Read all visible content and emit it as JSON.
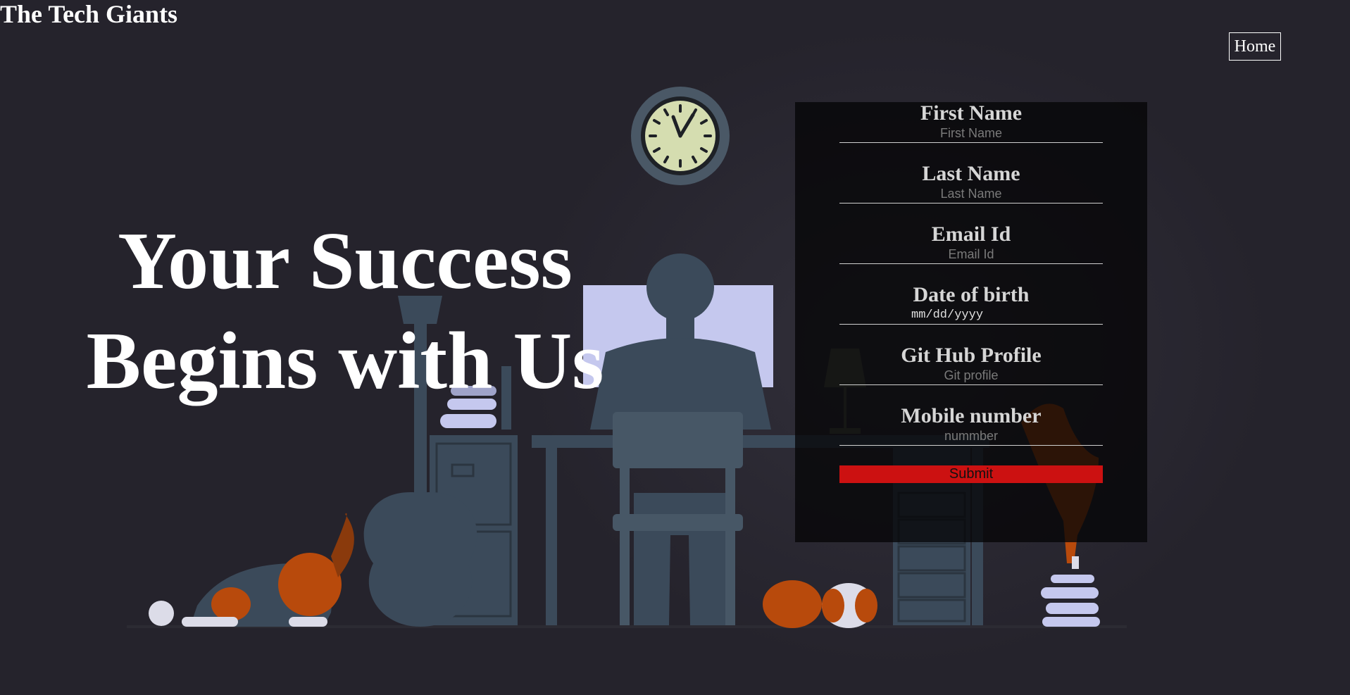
{
  "brand": {
    "title": "The Tech Giants"
  },
  "nav": {
    "home_label": "Home"
  },
  "hero": {
    "line1": "Your Success",
    "line2": "Begins with Us"
  },
  "form": {
    "fields": [
      {
        "label": "First Name",
        "placeholder": "First Name"
      },
      {
        "label": "Last Name",
        "placeholder": "Last Name"
      },
      {
        "label": "Email Id",
        "placeholder": "Email Id"
      },
      {
        "label": "Date of birth",
        "value": "mm/dd/yyyy"
      },
      {
        "label": "Git Hub Profile",
        "placeholder": "Git profile"
      },
      {
        "label": "Mobile number",
        "placeholder": "nummber"
      }
    ],
    "submit_label": "Submit"
  },
  "colors": {
    "background": "#25232c",
    "submit": "#cc1111",
    "dog_orange": "#b84a0c",
    "silhouette": "#3b4a5a",
    "monitor_glow": "#c5c8ee",
    "clock_face": "#d8e0b0"
  }
}
